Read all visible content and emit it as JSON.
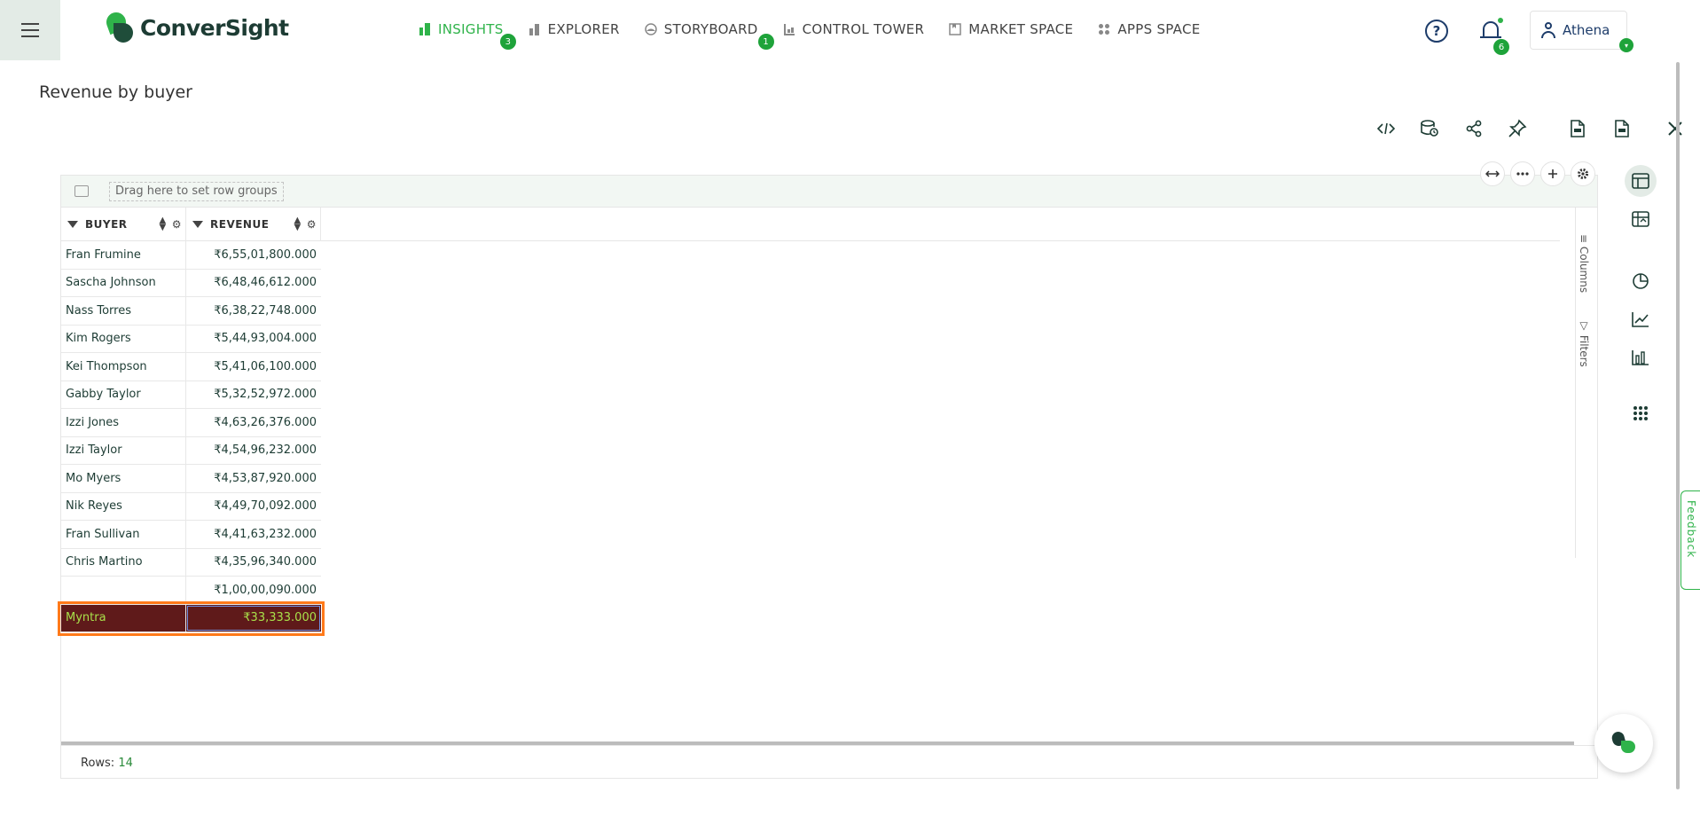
{
  "brand": {
    "name": "ConverSight"
  },
  "nav": [
    {
      "label": "INSIGHTS",
      "badge": "3",
      "active": true
    },
    {
      "label": "EXPLORER"
    },
    {
      "label": "STORYBOARD",
      "badge": "1"
    },
    {
      "label": "CONTROL TOWER"
    },
    {
      "label": "MARKET SPACE"
    },
    {
      "label": "APPS SPACE"
    }
  ],
  "header": {
    "help_label": "?",
    "notifications_badge": "6",
    "user_name": "Athena",
    "user_caret": "▾"
  },
  "page": {
    "title": "Revenue by buyer"
  },
  "grid": {
    "group_hint": "Drag here to set row groups",
    "columns": [
      {
        "label": "BUYER"
      },
      {
        "label": "REVENUE"
      }
    ],
    "rows": [
      {
        "buyer": "Fran Frumine",
        "revenue": "₹6,55,01,800.000"
      },
      {
        "buyer": "Sascha Johnson",
        "revenue": "₹6,48,46,612.000"
      },
      {
        "buyer": "Nass Torres",
        "revenue": "₹6,38,22,748.000"
      },
      {
        "buyer": "Kim Rogers",
        "revenue": "₹5,44,93,004.000"
      },
      {
        "buyer": "Kei Thompson",
        "revenue": "₹5,41,06,100.000"
      },
      {
        "buyer": "Gabby Taylor",
        "revenue": "₹5,32,52,972.000"
      },
      {
        "buyer": "Izzi Jones",
        "revenue": "₹4,63,26,376.000"
      },
      {
        "buyer": "Izzi Taylor",
        "revenue": "₹4,54,96,232.000"
      },
      {
        "buyer": "Mo Myers",
        "revenue": "₹4,53,87,920.000"
      },
      {
        "buyer": "Nik Reyes",
        "revenue": "₹4,49,70,092.000"
      },
      {
        "buyer": "Fran Sullivan",
        "revenue": "₹4,41,63,232.000"
      },
      {
        "buyer": "Chris Martino",
        "revenue": "₹4,35,96,340.000"
      },
      {
        "buyer": "",
        "revenue": "₹1,00,00,090.000"
      },
      {
        "buyer": "Myntra",
        "revenue": "₹33,333.000",
        "selected": true
      }
    ],
    "side_tabs": {
      "columns": "Columns",
      "filters": "Filters"
    },
    "status": {
      "label": "Rows:",
      "value": "14"
    }
  },
  "feedback_label": "Feedback",
  "colors": {
    "accent": "#2fb34a",
    "selected_row_bg": "#5f1a1a",
    "selected_outline": "#ff7a1a"
  }
}
